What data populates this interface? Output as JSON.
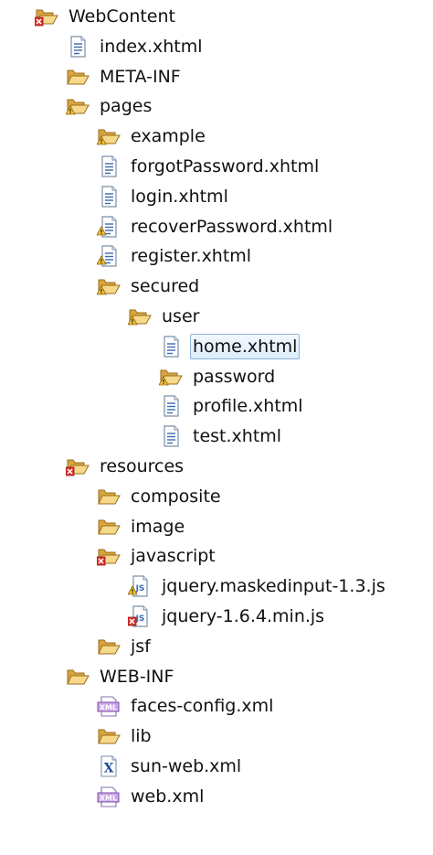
{
  "tree": {
    "items": [
      {
        "label": "WebContent",
        "icon": "folder-open-error-icon",
        "depth": 0
      },
      {
        "label": "index.xhtml",
        "icon": "xhtml-file-icon",
        "depth": 1
      },
      {
        "label": "META-INF",
        "icon": "folder-open-icon",
        "depth": 1
      },
      {
        "label": "pages",
        "icon": "folder-open-warning-icon",
        "depth": 1
      },
      {
        "label": "example",
        "icon": "folder-open-warning-icon",
        "depth": 2
      },
      {
        "label": "forgotPassword.xhtml",
        "icon": "xhtml-file-icon",
        "depth": 2
      },
      {
        "label": "login.xhtml",
        "icon": "xhtml-file-icon",
        "depth": 2
      },
      {
        "label": "recoverPassword.xhtml",
        "icon": "xhtml-file-warning-icon",
        "depth": 2
      },
      {
        "label": "register.xhtml",
        "icon": "xhtml-file-warning-icon",
        "depth": 2
      },
      {
        "label": "secured",
        "icon": "folder-open-warning-icon",
        "depth": 2
      },
      {
        "label": "user",
        "icon": "folder-open-warning-icon",
        "depth": 3
      },
      {
        "label": "home.xhtml",
        "icon": "xhtml-file-icon",
        "depth": 4,
        "selected": true
      },
      {
        "label": "password",
        "icon": "folder-open-warning-icon",
        "depth": 4
      },
      {
        "label": "profile.xhtml",
        "icon": "xhtml-file-icon",
        "depth": 4
      },
      {
        "label": "test.xhtml",
        "icon": "xhtml-file-icon",
        "depth": 4
      },
      {
        "label": "resources",
        "icon": "folder-open-error-icon",
        "depth": 1
      },
      {
        "label": "composite",
        "icon": "folder-open-icon",
        "depth": 2
      },
      {
        "label": "image",
        "icon": "folder-open-icon",
        "depth": 2
      },
      {
        "label": "javascript",
        "icon": "folder-open-error-icon",
        "depth": 2
      },
      {
        "label": "jquery.maskedinput-1.3.js",
        "icon": "js-file-warning-icon",
        "depth": 3
      },
      {
        "label": "jquery-1.6.4.min.js",
        "icon": "js-file-error-icon",
        "depth": 3
      },
      {
        "label": "jsf",
        "icon": "folder-open-icon",
        "depth": 2
      },
      {
        "label": "WEB-INF",
        "icon": "folder-open-icon",
        "depth": 1
      },
      {
        "label": "faces-config.xml",
        "icon": "xml-file-icon",
        "depth": 2
      },
      {
        "label": "lib",
        "icon": "folder-open-icon",
        "depth": 2
      },
      {
        "label": "sun-web.xml",
        "icon": "xml-x-file-icon",
        "depth": 2
      },
      {
        "label": "web.xml",
        "icon": "xml-file-icon",
        "depth": 2
      }
    ]
  }
}
